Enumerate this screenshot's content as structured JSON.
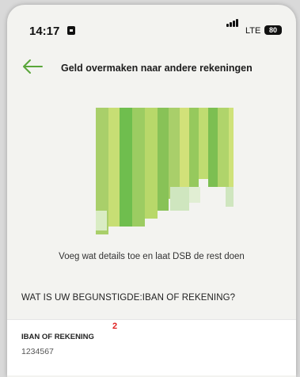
{
  "status_bar": {
    "time": "14:17",
    "network": "LTE",
    "battery": "80"
  },
  "header": {
    "title": "Geld overmaken naar andere rekeningen",
    "back_icon": "arrow-left-icon",
    "accent_color": "#5aa63a"
  },
  "content": {
    "hint": "Voeg wat details toe en laat DSB de rest doen",
    "section_label": "WAT IS UW BEGUNSTIGDE:IBAN OF REKENING?"
  },
  "iban_field": {
    "label": "IBAN OF REKENING",
    "badge": "2",
    "value": "1234567"
  }
}
